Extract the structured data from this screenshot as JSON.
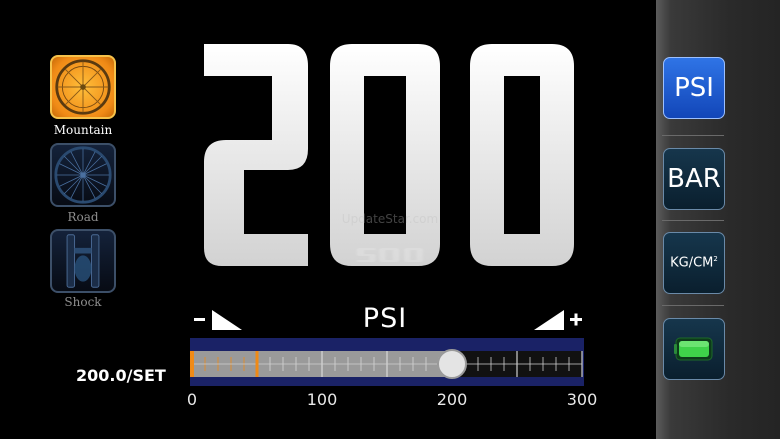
{
  "bike_types": [
    {
      "label": "Mountain",
      "icon": "mountain-wheel-icon",
      "active": true
    },
    {
      "label": "Road",
      "icon": "road-wheel-icon",
      "active": false
    },
    {
      "label": "Shock",
      "icon": "shock-fork-icon",
      "active": false
    }
  ],
  "display": {
    "value": "200",
    "unit": "PSI",
    "watermark": "UpdateStar.com",
    "setpoint": "200.0/SET"
  },
  "slider": {
    "minus_label": "−",
    "plus_label": "+",
    "ticks": [
      "0",
      "100",
      "200",
      "300"
    ],
    "min": 0,
    "max": 300,
    "current": 200,
    "preset_marker": 50
  },
  "units": [
    {
      "label": "PSI",
      "active": true
    },
    {
      "label": "BAR",
      "active": false
    },
    {
      "label": "KG/CM",
      "sup": "2",
      "active": false
    }
  ],
  "battery_icon": "battery-icon",
  "colors": {
    "accent_orange": "#f08a16",
    "active_blue": "#2f74e6",
    "inactive_teal": "#16364c"
  }
}
